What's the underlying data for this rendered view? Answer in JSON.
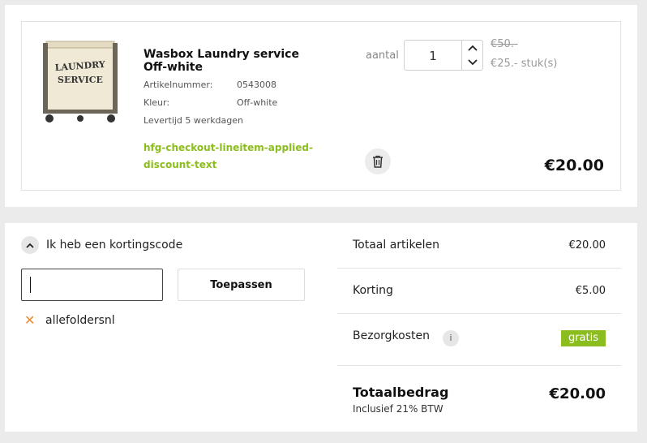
{
  "cart_item": {
    "title": "Wasbox Laundry service Off-white",
    "image_text_line1": "LAUNDRY",
    "image_text_line2": "SERVICE",
    "article_number_label": "Artikelnummer:",
    "article_number": "0543008",
    "color_label": "Kleur:",
    "color": "Off-white",
    "delivery_time": "Levertijd 5 werkdagen",
    "discount_text": "hfg-checkout-lineitem-applied-discount-text",
    "quantity_label": "aantal",
    "quantity": "1",
    "old_price": "€50.-",
    "unit_price": "€25.- stuk(s)",
    "line_total": "€20.00"
  },
  "coupon": {
    "toggle_label": "Ik heb een kortingscode",
    "input_value": "",
    "apply_label": "Toepassen",
    "applied_code": "allefoldersnl"
  },
  "summary": {
    "items_label": "Totaal artikelen",
    "items_value": "€20.00",
    "discount_label": "Korting",
    "discount_value": "€5.00",
    "shipping_label": "Bezorgkosten",
    "shipping_info": "i",
    "shipping_value": "gratis",
    "total_label": "Totaalbedrag",
    "total_sub": "Inclusief 21% BTW",
    "total_value": "€20.00"
  },
  "colors": {
    "accent_green": "#8cbd1e",
    "remove_orange": "#e8892b"
  }
}
